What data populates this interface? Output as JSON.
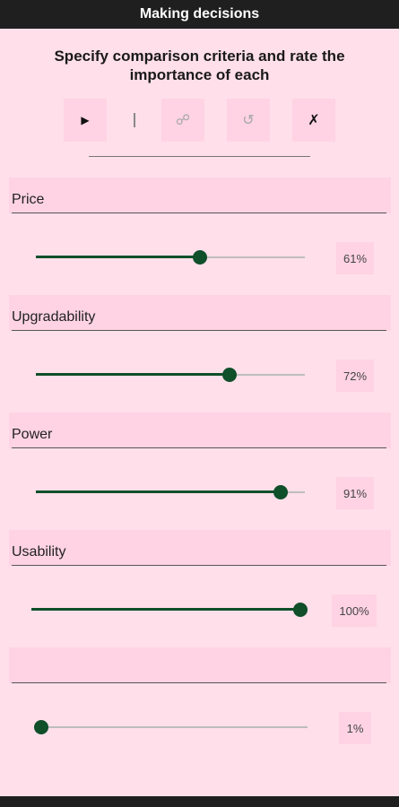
{
  "app": {
    "title": "Making decisions"
  },
  "heading": {
    "line1": "Specify comparison criteria and rate the",
    "line2": "importance of each"
  },
  "toolbar": {
    "play_glyph": "▶",
    "link_glyph": "☍",
    "undo_glyph": "↺",
    "clear_glyph": "✗",
    "icons": [
      "play-icon",
      "link-icon",
      "undo-icon",
      "clear-icon"
    ]
  },
  "criteria": [
    {
      "name": "Price",
      "importance": 61,
      "label": "61%"
    },
    {
      "name": "Upgradability",
      "importance": 72,
      "label": "72%"
    },
    {
      "name": "Power",
      "importance": 91,
      "label": "91%"
    },
    {
      "name": "Usability",
      "importance": 100,
      "label": "100%"
    },
    {
      "name": "",
      "importance": 1,
      "label": "1%"
    }
  ],
  "colors": {
    "background": "#ffdfea",
    "field": "#ffd3e3",
    "accent": "#0f4f2a",
    "titlebar": "#1f1f1f"
  }
}
